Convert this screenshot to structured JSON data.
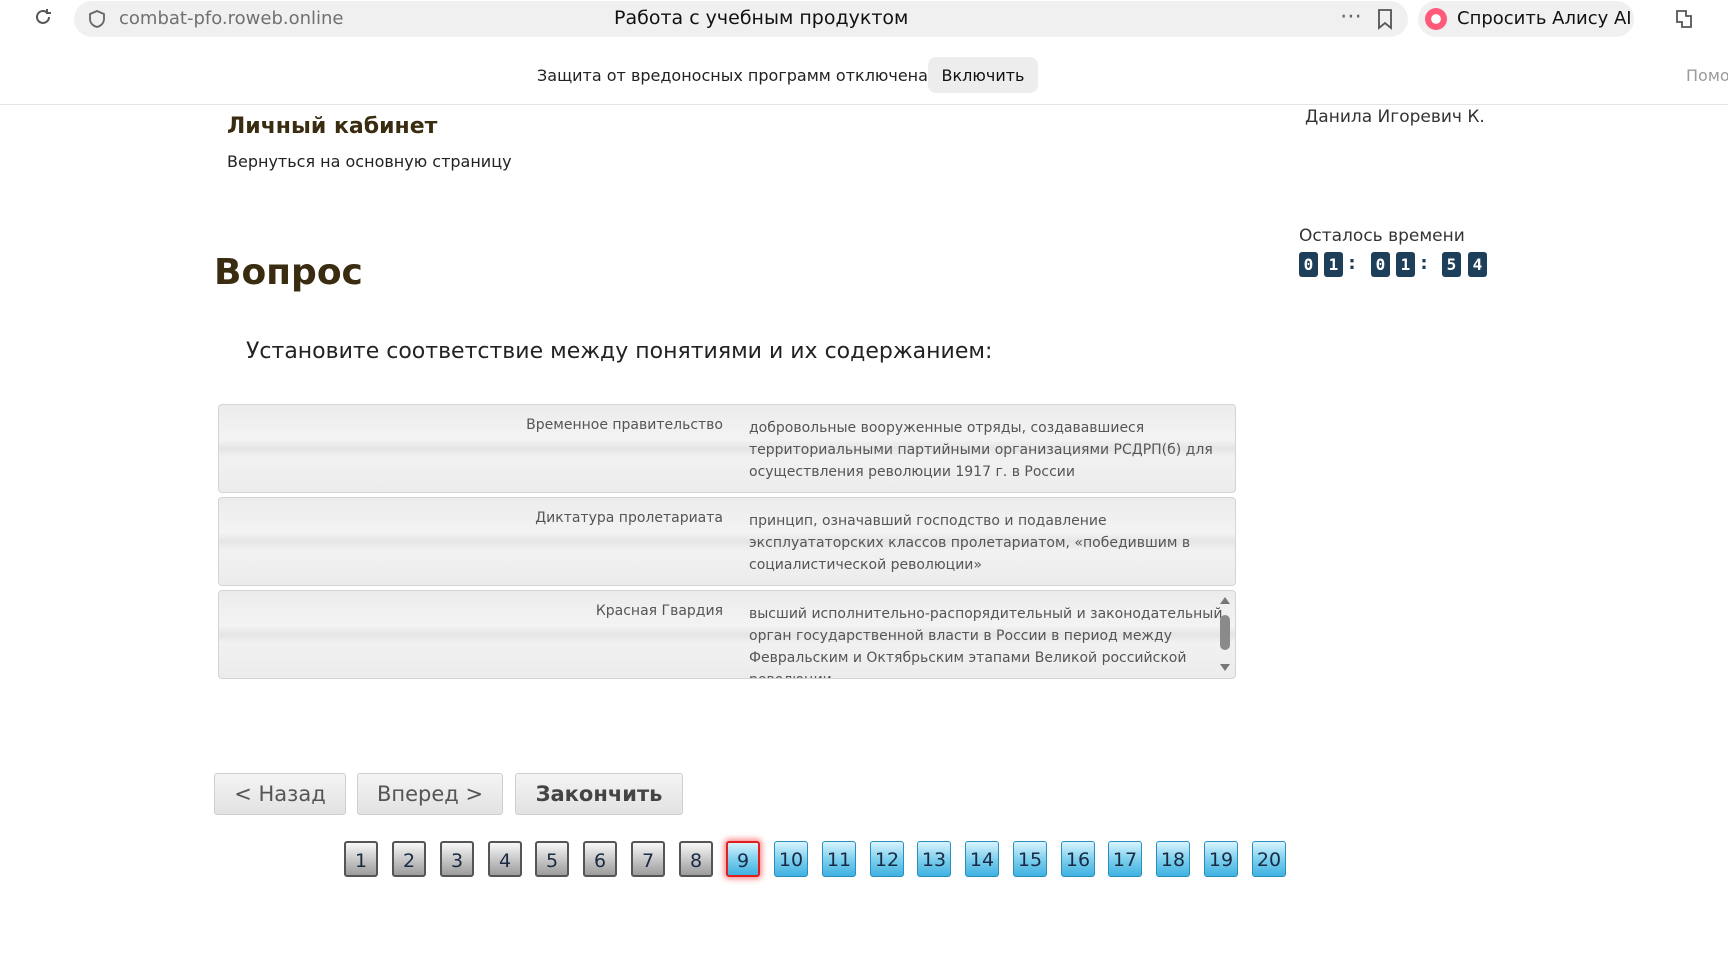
{
  "browser": {
    "url": "combat-pfo.roweb.online",
    "tab_title": "Работа с учебным продуктом",
    "alice_label": "Спросить Алису AI"
  },
  "protection": {
    "message": "Защита от вредоносных программ отключена",
    "enable_label": "Включить",
    "help_cut": "Помо"
  },
  "header": {
    "cabinet_title": "Личный кабинет",
    "back_link": "Вернуться на основную страницу",
    "user_name": "Данила Игоревич К."
  },
  "timer": {
    "label": "Осталось времени",
    "digits": [
      "0",
      "1",
      "0",
      "1",
      "5",
      "4"
    ]
  },
  "question": {
    "heading": "Вопрос",
    "text": "Установите соответствие между понятиями и их содержанием:",
    "pairs": [
      {
        "concept": "Временное правительство",
        "definition": "добровольные вооруженные отряды, создававшиеся территориальными партийными организациями РСДРП(б) для осуществления революции 1917 г. в России"
      },
      {
        "concept": "Диктатура пролетариата",
        "definition": "принцип, означавший господство и подавление эксплуататорских классов пролетариатом, «победившим в социалистической революции»"
      },
      {
        "concept": "Красная Гвардия",
        "definition": "высший исполнительно-распорядительный и законодательный орган государственной власти в России в период между Февральским и Октябрьским этапами Великой российской революции"
      }
    ]
  },
  "nav": {
    "back": "< Назад",
    "forward": "Вперед >",
    "finish": "Закончить"
  },
  "pages": {
    "numbers": [
      "1",
      "2",
      "3",
      "4",
      "5",
      "6",
      "7",
      "8",
      "9",
      "10",
      "11",
      "12",
      "13",
      "14",
      "15",
      "16",
      "17",
      "18",
      "19",
      "20"
    ],
    "current": "9",
    "answered": [
      "1",
      "2",
      "3",
      "4",
      "5",
      "6",
      "7",
      "8"
    ]
  }
}
